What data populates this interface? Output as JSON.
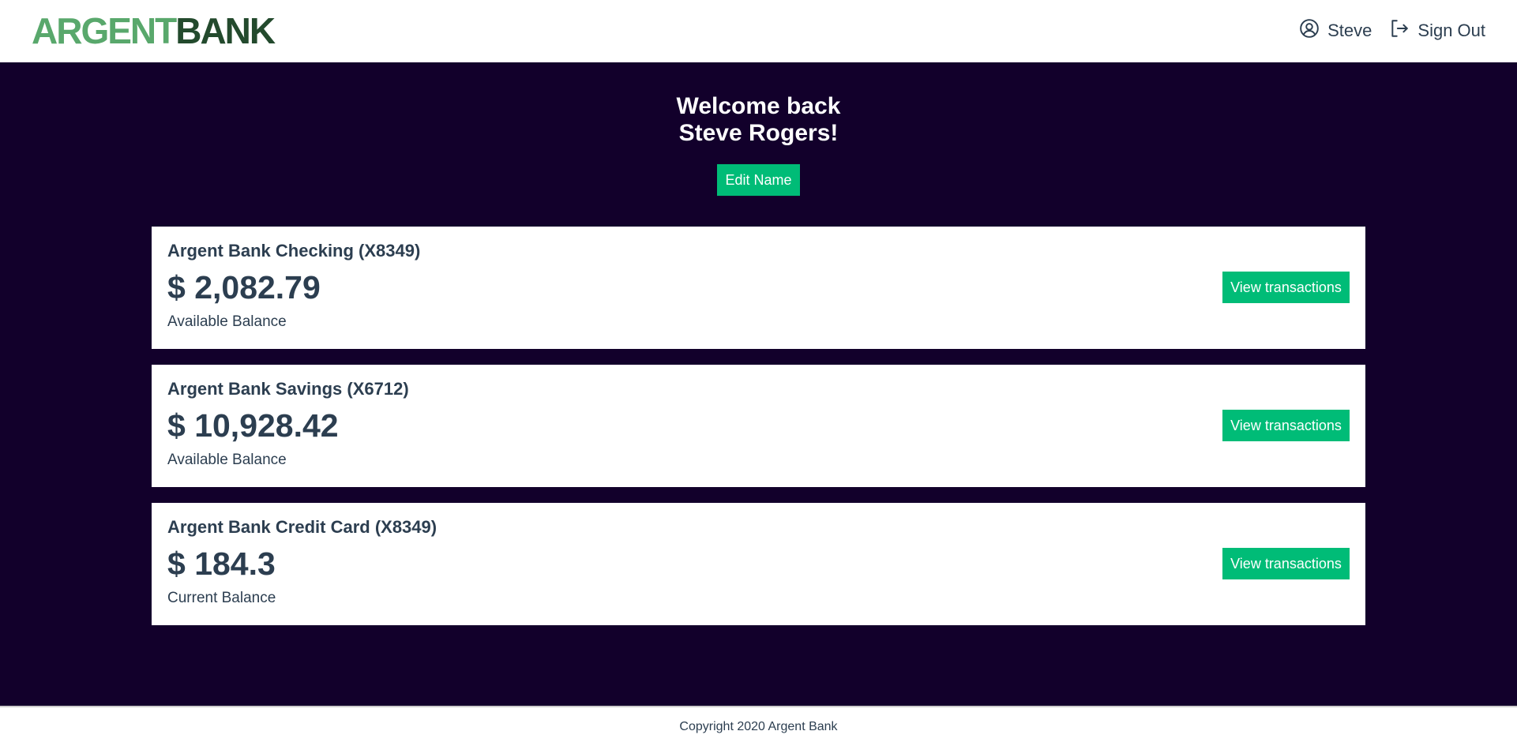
{
  "nav": {
    "logo_part1": "ARGENT",
    "logo_part2": "BANK",
    "user_label": "Steve",
    "user_icon": "user-circle-icon",
    "signout_label": "Sign Out",
    "signout_icon": "sign-out-icon"
  },
  "header": {
    "line1": "Welcome back",
    "line2": "Steve Rogers!",
    "edit_label": "Edit Name"
  },
  "accounts": [
    {
      "title": "Argent Bank Checking (X8349)",
      "amount": "$ 2,082.79",
      "description": "Available Balance",
      "button": "View transactions"
    },
    {
      "title": "Argent Bank Savings (X6712)",
      "amount": "$ 10,928.42",
      "description": "Available Balance",
      "button": "View transactions"
    },
    {
      "title": "Argent Bank Credit Card (X8349)",
      "amount": "$ 184.3",
      "description": "Current Balance",
      "button": "View transactions"
    }
  ],
  "footer": {
    "copyright": "Copyright 2020 Argent Bank"
  },
  "colors": {
    "background": "#12002b",
    "accent": "#00bc77",
    "logo_light": "#59a86c",
    "logo_dark": "#234a2d",
    "text": "#2c3e50"
  }
}
